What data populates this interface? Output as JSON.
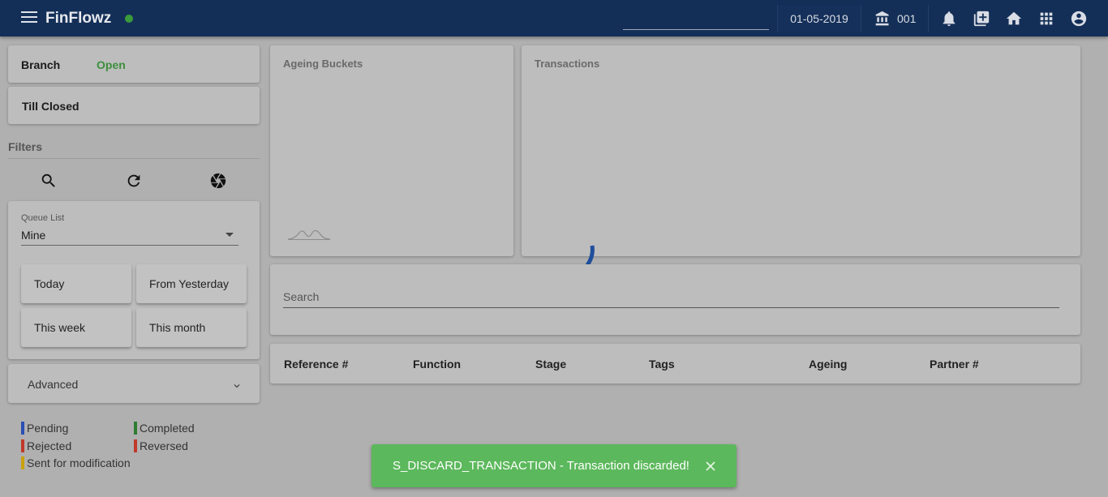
{
  "app": {
    "title": "FinFlowz",
    "date": "01-05-2019",
    "branch_code": "001"
  },
  "status": {
    "branch_label": "Branch",
    "branch_state": "Open",
    "till_label": "Till Closed"
  },
  "filters": {
    "title": "Filters",
    "queue_label": "Queue List",
    "queue_value": "Mine",
    "buttons": [
      "Today",
      "From Yesterday",
      "This week",
      "This month"
    ],
    "advanced": "Advanced"
  },
  "legend": [
    {
      "label": "Pending",
      "color": "#2b4fb5"
    },
    {
      "label": "Completed",
      "color": "#2e7d32"
    },
    {
      "label": "Rejected",
      "color": "#c0392b"
    },
    {
      "label": "Reversed",
      "color": "#c0392b"
    },
    {
      "label": "Sent for modification",
      "color": "#c9a10c"
    }
  ],
  "panels": {
    "ageing_title": "Ageing Buckets",
    "transactions_title": "Transactions"
  },
  "search": {
    "label": "Search"
  },
  "table": {
    "columns": [
      "Reference #",
      "Function",
      "Stage",
      "Tags",
      "Ageing",
      "Partner #"
    ]
  },
  "toast": {
    "message": "S_DISCARD_TRANSACTION - Transaction discarded!"
  },
  "colors": {
    "header": "#142f57",
    "open_status": "#3d8f3d",
    "toast": "#5cb85c",
    "spinner": "#1f4f9c"
  }
}
